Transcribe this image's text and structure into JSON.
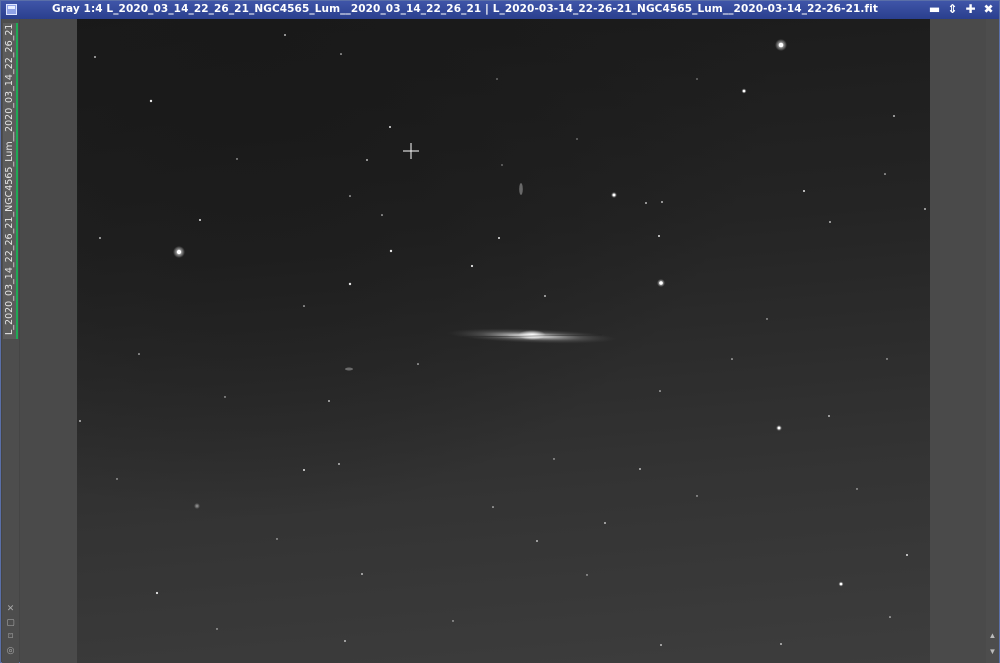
{
  "window": {
    "title": "Gray 1:4 L_2020_03_14_22_26_21_NGC4565_Lum__2020_03_14_22_26_21 | L_2020-03-14_22-26-21_NGC4565_Lum__2020-03-14_22-26-21.fit",
    "controls": [
      {
        "name": "minimize-button",
        "glyph": "▬"
      },
      {
        "name": "shade-button",
        "glyph": "⇕"
      },
      {
        "name": "maximize-button",
        "glyph": "✚"
      },
      {
        "name": "close-button",
        "glyph": "✖"
      }
    ]
  },
  "side_tab": {
    "label": "L_2020_03_14_22_26_21_NGC4565_Lum__2020_03_14_22_26_21",
    "accent_color": "#1faa55"
  },
  "left_tools": [
    "✕",
    "▢",
    "⌑",
    "◎"
  ],
  "scrollbar": {
    "up": "▲",
    "down": "▼"
  },
  "colors": {
    "title_bar": "#2a3f8e",
    "image_background": "#2a2a2a"
  }
}
